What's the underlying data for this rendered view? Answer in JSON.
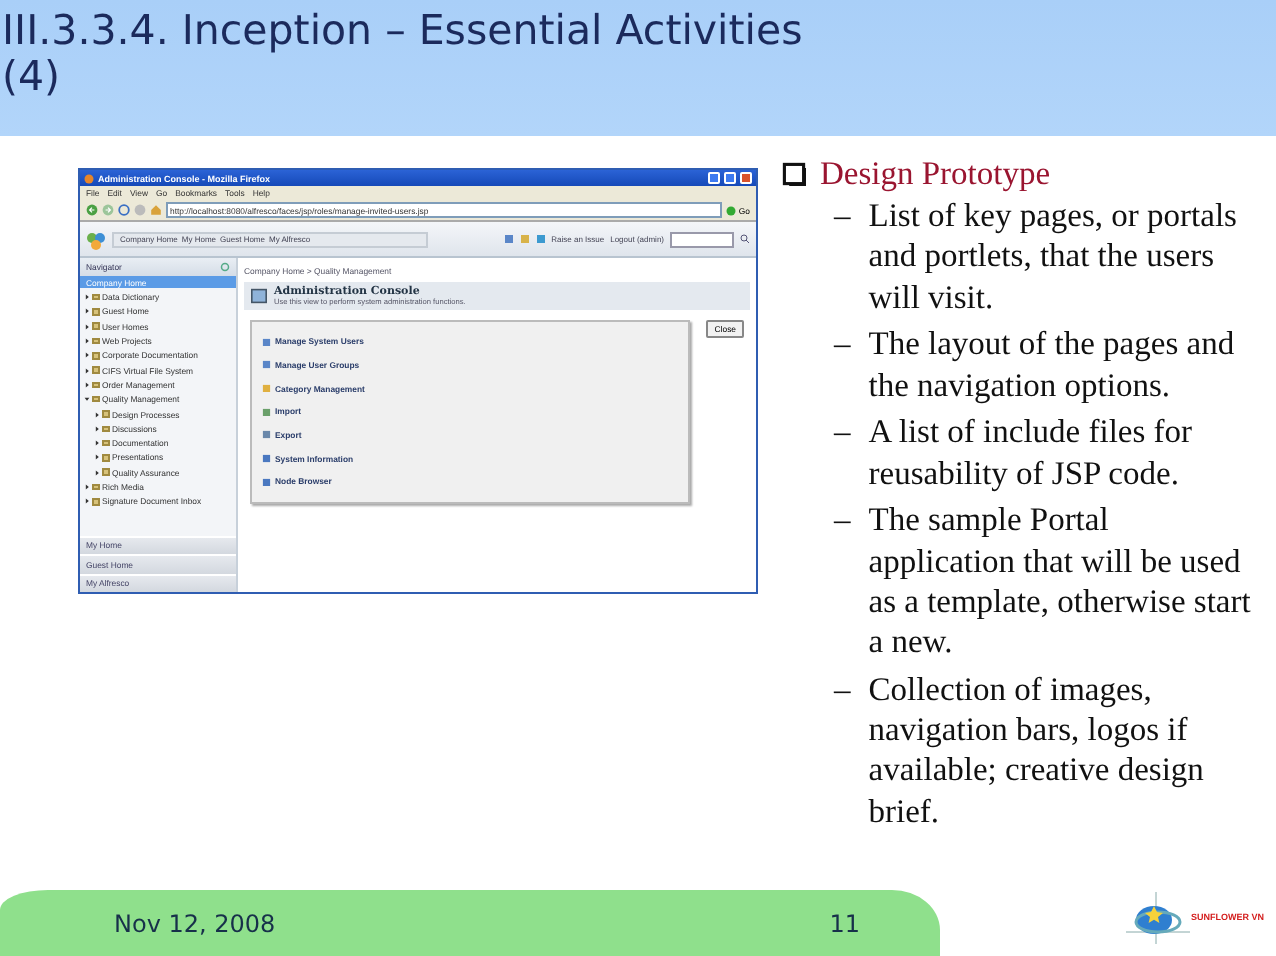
{
  "slide": {
    "title": "III.3.3.4. Inception – Essential Activities (4)"
  },
  "screenshot": {
    "window_title": "Administration Console - Mozilla Firefox",
    "menu": [
      "File",
      "Edit",
      "View",
      "Go",
      "Bookmarks",
      "Tools",
      "Help"
    ],
    "url": "http://localhost:8080/alfresco/faces/jsp/roles/manage-invited-users.jsp",
    "go_label": "Go",
    "header_links": [
      "Company Home",
      "My Home",
      "Guest Home",
      "My Alfresco"
    ],
    "header_actions": [
      "Raise an Issue",
      "Logout (admin)"
    ],
    "navigator": {
      "label": "Navigator",
      "root": {
        "label": "Company Home",
        "selected": true
      },
      "tree": [
        {
          "label": "Data Dictionary",
          "expanded": false
        },
        {
          "label": "Guest Home",
          "expanded": false
        },
        {
          "label": "User Homes",
          "expanded": false
        },
        {
          "label": "Web Projects",
          "expanded": false
        },
        {
          "label": "Corporate Documentation",
          "expanded": false
        },
        {
          "label": "CIFS Virtual File System",
          "expanded": false
        },
        {
          "label": "Order Management",
          "expanded": false
        },
        {
          "label": "Quality Management",
          "expanded": true,
          "children": [
            {
              "label": "Design Processes",
              "expanded": false
            },
            {
              "label": "Discussions",
              "expanded": false
            },
            {
              "label": "Documentation",
              "expanded": false
            },
            {
              "label": "Presentations",
              "expanded": false
            },
            {
              "label": "Quality Assurance",
              "expanded": false
            }
          ]
        },
        {
          "label": "Rich Media",
          "expanded": false
        },
        {
          "label": "Signature Document Inbox",
          "expanded": false
        }
      ],
      "panels": [
        "My Home",
        "Guest Home",
        "My Alfresco"
      ]
    },
    "breadcrumb": "Company Home > Quality Management",
    "page_title": "Administration Console",
    "page_subtitle": "Use this view to perform system administration functions.",
    "close_label": "Close",
    "actions": [
      "Manage System Users",
      "Manage User Groups",
      "Category Management",
      "Import",
      "Export",
      "System Information",
      "Node Browser"
    ]
  },
  "content": {
    "heading": "Design Prototype",
    "items": [
      {
        "marker": "–",
        "text": "List of key pages, or portals and portlets, that the users will visit."
      },
      {
        "marker": "–",
        "text": "The layout of the pages and the navigation options."
      },
      {
        "marker": "–",
        "text": "A list of include files for reusability of JSP code."
      },
      {
        "marker": "–",
        "text": "The sample Portal application that will be used as a template, otherwise start a new."
      },
      {
        "marker": "–",
        "text": "Collection of images, navigation bars, logos if available; creative design brief."
      }
    ]
  },
  "footer": {
    "date": "Nov 12, 2008",
    "page": "11",
    "logo_text": "SUNFLOWER VN"
  }
}
